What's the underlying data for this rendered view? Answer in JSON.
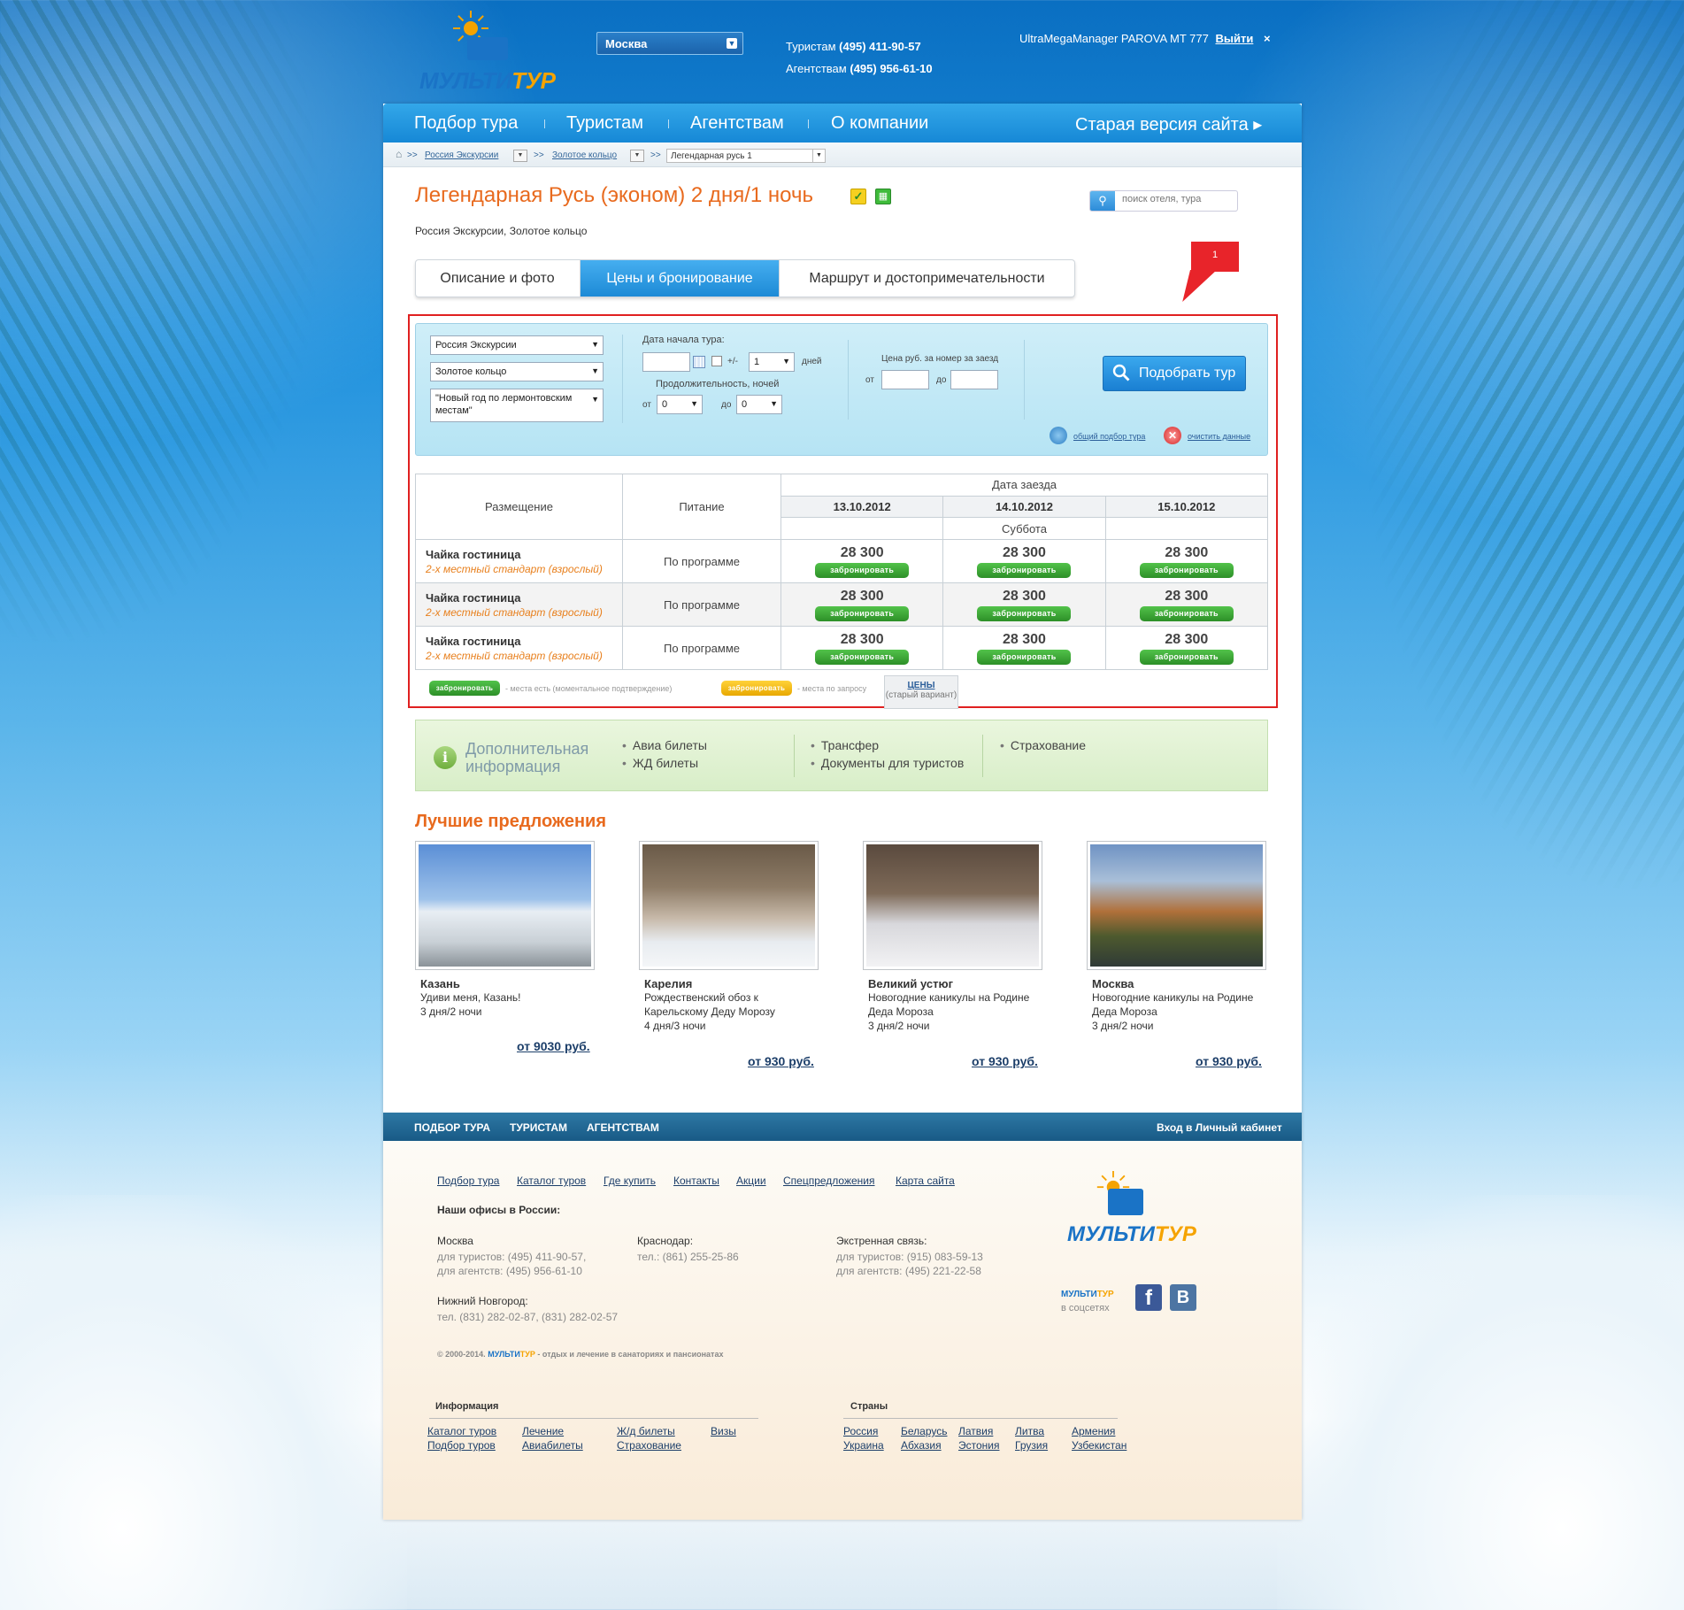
{
  "header": {
    "logo": {
      "part1": "МУЛЬТИ",
      "part2": "ТУР"
    },
    "city": "Москва",
    "phones": {
      "tourists_label": "Туристам",
      "tourists_phone": "(495) 411-90-57",
      "agents_label": "Агентствам",
      "agents_phone": "(495) 956-61-10"
    },
    "user": {
      "name": "UltraMegaManager PAROVA MT 777",
      "logout": "Выйти",
      "close": "×"
    }
  },
  "nav": {
    "items": [
      "Подбор тура",
      "Туристам",
      "Агентствам",
      "О компании"
    ],
    "old_site": "Старая версия сайта ▸"
  },
  "breadcrumb": {
    "sep": ">>",
    "items": [
      "Россия Экскурсии",
      "Золотое кольцо"
    ],
    "current": "Легендарная русь 1"
  },
  "tour": {
    "title": "Легендарная Русь (эконом) 2 дня/1 ночь",
    "subtitle": "Россия Экскурсии, Золотое кольцо"
  },
  "search": {
    "placeholder": "поиск отеля, тура"
  },
  "tabs": [
    "Описание и фото",
    "Цены и бронирование",
    "Маршрут и достопримечательности"
  ],
  "callout": "1",
  "filter": {
    "country": "Россия Экскурсии",
    "region": "Золотое кольцо",
    "tour": "\"Новый год по лермонтовским местам\"",
    "date_label": "Дата начала тура:",
    "plusminus": "+/-",
    "days_value": "1",
    "days_label": "дней",
    "duration_label": "Продолжительность, ночей",
    "from": "от",
    "to": "до",
    "nights_from": "0",
    "nights_to": "0",
    "price_label": "Цена руб. за номер за заезд",
    "submit": "Подобрать тур",
    "general_search": "общий подбор тура",
    "clear": "очистить данные"
  },
  "prices": {
    "col_accommodation": "Размещение",
    "col_meals": "Питание",
    "col_date": "Дата заезда",
    "dates": [
      "13.10.2012",
      "14.10.2012",
      "15.10.2012"
    ],
    "weekdays": [
      "",
      "Суббота",
      ""
    ],
    "book_label": "забронировать",
    "rows": [
      {
        "hotel": "Чайка гостиница",
        "room": "2-х местный стандарт (взрослый)",
        "meals": "По программе",
        "prices": [
          "28 300",
          "28 300",
          "28 300"
        ]
      },
      {
        "hotel": "Чайка гостиница",
        "room": "2-х местный стандарт (взрослый)",
        "meals": "По программе",
        "prices": [
          "28 300",
          "28 300",
          "28 300"
        ]
      },
      {
        "hotel": "Чайка гостиница",
        "room": "2-х местный стандарт (взрослый)",
        "meals": "По программе",
        "prices": [
          "28 300",
          "28 300",
          "28 300"
        ]
      }
    ],
    "legend_instant": "- места есть (моментальное подтверждение)",
    "legend_request": "- места по запросу",
    "old_prices_title": "ЦЕНЫ",
    "old_prices_sub": "(старый вариант)"
  },
  "extra": {
    "title_line1": "Дополнительная",
    "title_line2": "информация",
    "col1": [
      "Авиа билеты",
      "ЖД билеты"
    ],
    "col2": [
      "Трансфер",
      "Документы для туристов"
    ],
    "col3": [
      "Страхование"
    ]
  },
  "best": {
    "title": "Лучшие предложения",
    "offers": [
      {
        "city": "Казань",
        "line1": "Удиви меня, Казань!",
        "line2": "",
        "duration": "3 дня/2 ночи",
        "price": "от 9030 руб."
      },
      {
        "city": "Карелия",
        "line1": "Рождественский обоз к",
        "line2": "Карельскому Деду Морозу",
        "duration": "4 дня/3 ночи",
        "price": "от 930 руб."
      },
      {
        "city": "Великий устюг",
        "line1": "Новогодние каникулы на Родине",
        "line2": "Деда Мороза",
        "duration": "3 дня/2 ночи",
        "price": "от 930 руб."
      },
      {
        "city": "Москва",
        "line1": "Новогодние каникулы на Родине",
        "line2": "Деда Мороза",
        "duration": "3 дня/2 ночи",
        "price": "от 930 руб."
      }
    ]
  },
  "footer": {
    "bar": [
      "ПОДБОР ТУРА",
      "ТУРИСТАМ",
      "АГЕНТСТВАМ"
    ],
    "cabinet": "Вход в Личный кабинет",
    "links": [
      "Подбор тура",
      "Каталог туров",
      "Где купить",
      "Контакты",
      "Акции",
      "Спецпредложения",
      "Карта сайта"
    ],
    "offices_title": "Наши офисы в России:",
    "moscow": {
      "city": "Москва",
      "l1": "для туристов: (495) 411-90-57,",
      "l2": "для агентств: (495) 956-61-10"
    },
    "krasnodar": {
      "city": "Краснодар:",
      "l1": "тел.: (861) 255-25-86"
    },
    "emergency": {
      "city": "Экстренная связь:",
      "l1": "для туристов: (915) 083-59-13",
      "l2": "для агентств: (495) 221-22-58"
    },
    "nn": {
      "city": "Нижний Новгород:",
      "l1": "тел. (831) 282-02-87, (831) 282-02-57"
    },
    "copyright_pre": "© 2000-2014.",
    "copyright_brand1": "МУЛЬТИ",
    "copyright_brand2": "ТУР",
    "copyright_post": "- отдых и лечение в санаториях и пансионатах",
    "social1": "МУЛЬТИ",
    "social2": "ТУР",
    "social_sub": "в соцсетях",
    "fb": "f",
    "vk": "B",
    "info_title": "Информация",
    "info_links": [
      "Каталог туров",
      "Подбор туров",
      "Лечение",
      "Авиабилеты",
      "Ж/д билеты",
      "Страхование",
      "Визы"
    ],
    "countries_title": "Страны",
    "countries": [
      "Россия",
      "Украина",
      "Беларусь",
      "Абхазия",
      "Латвия",
      "Эстония",
      "Литва",
      "Грузия",
      "Армения",
      "Узбекистан"
    ]
  },
  "colors": {
    "accent": "#1d8ad6",
    "title_orange": "#e86a1e",
    "book_green": "#2d8f28",
    "frame_red": "#e02020"
  }
}
